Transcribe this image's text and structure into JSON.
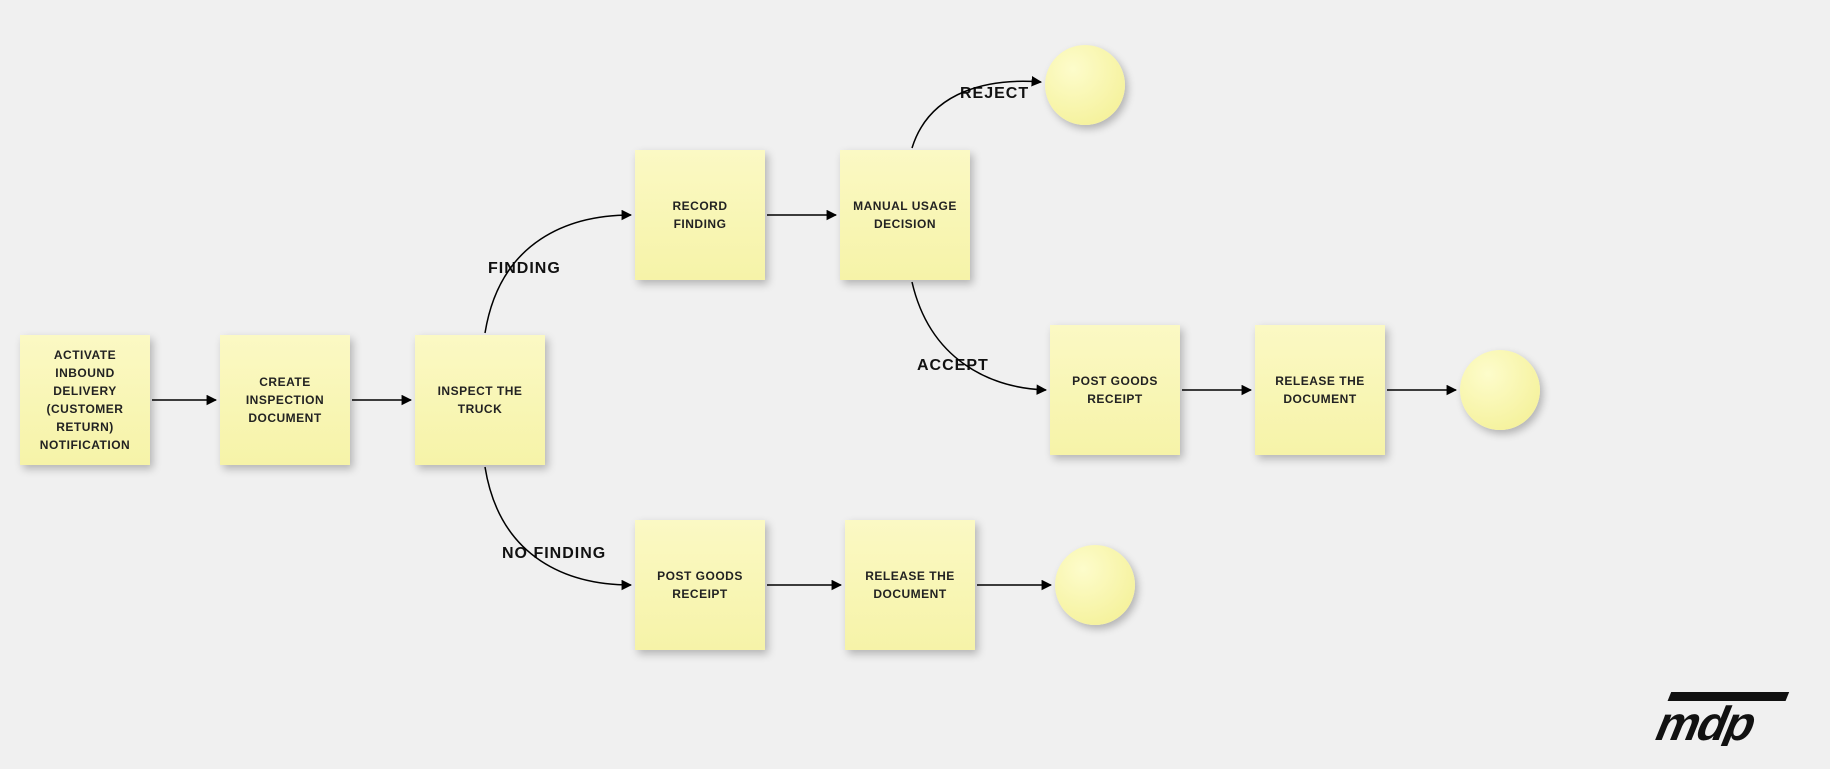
{
  "nodes": {
    "n1": "ACTIVATE INBOUND DELIVERY (CUSTOMER RETURN) NOTIFICATION",
    "n2": "CREATE INSPECTION DOCUMENT",
    "n3": "INSPECT THE TRUCK",
    "n4": "RECORD FINDING",
    "n5": "MANUAL USAGE DECISION",
    "n6": "POST GOODS RECEIPT",
    "n7": "RELEASE THE DOCUMENT",
    "n8": "POST GOODS RECEIPT",
    "n9": "RELEASE THE DOCUMENT"
  },
  "labels": {
    "finding": "FINDING",
    "no_finding": "NO FINDING",
    "reject": "REJECT",
    "accept": "ACCEPT"
  },
  "logo": "mdp"
}
